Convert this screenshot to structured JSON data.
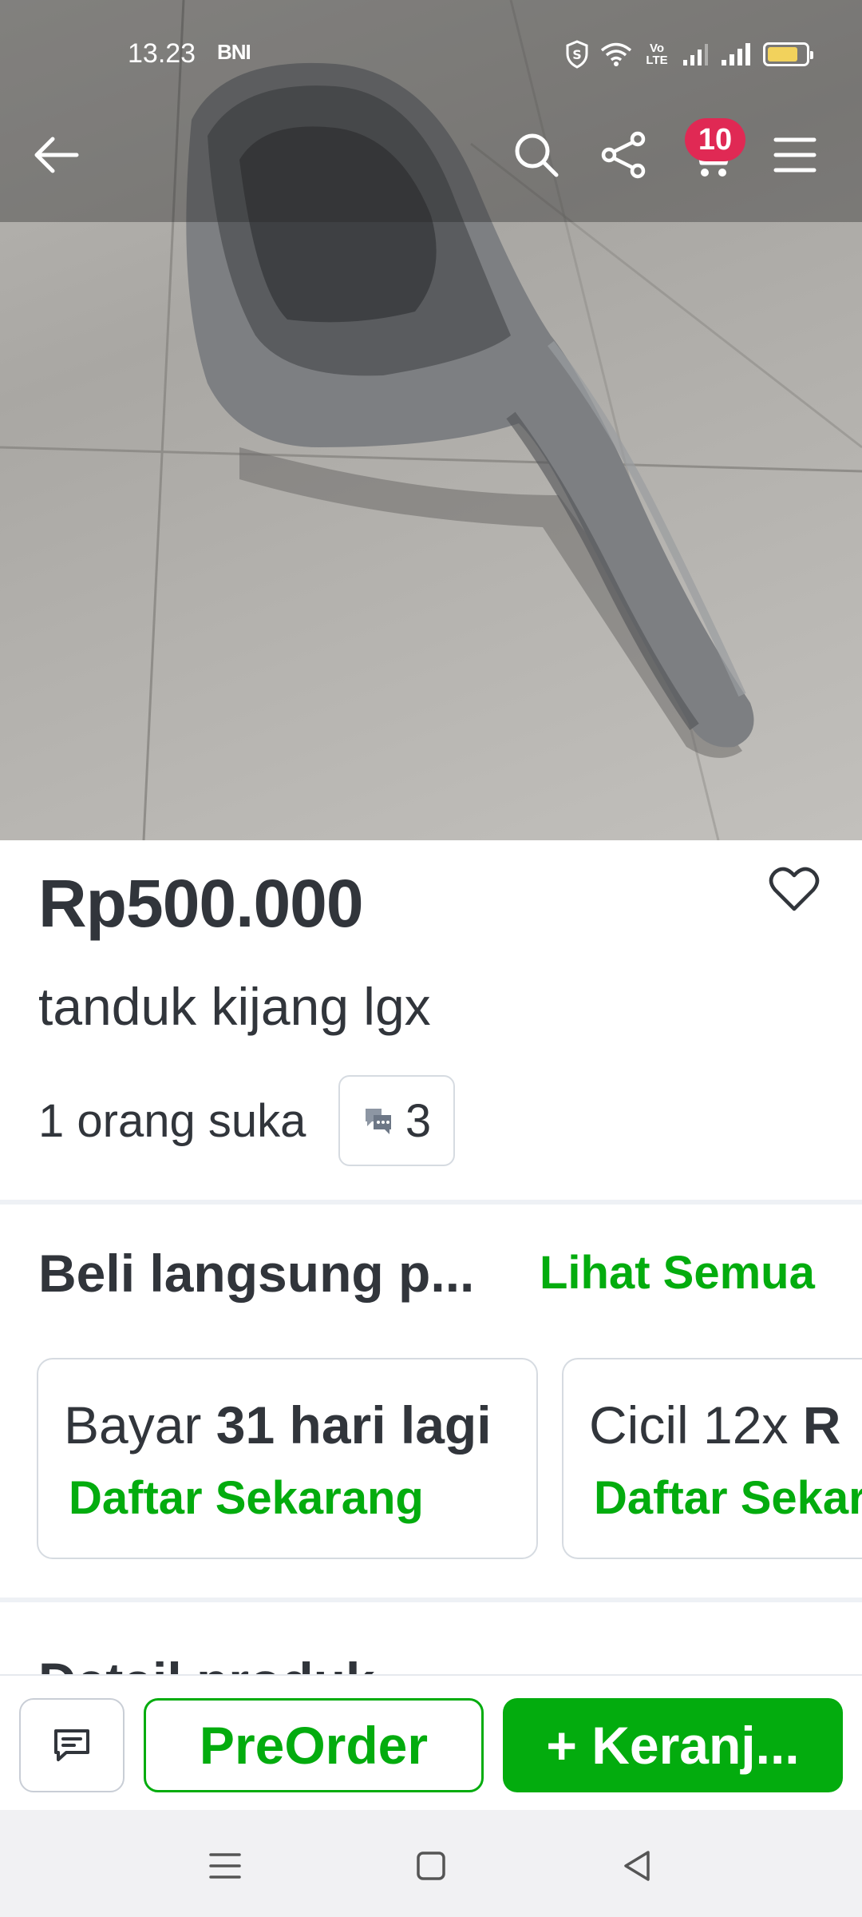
{
  "status_bar": {
    "time": "13.23",
    "carrier": "BNI",
    "volte": "Vo LTE",
    "battery_level": 0.8
  },
  "toolbar": {
    "cart_count": "10",
    "icons": [
      "back-arrow-icon",
      "search-icon",
      "share-icon",
      "cart-icon",
      "menu-icon"
    ]
  },
  "product": {
    "price": "Rp500.000",
    "title": "tanduk kijang lgx",
    "likes": "1 orang suka",
    "discussion_count": "3"
  },
  "payment_section": {
    "title": "Beli langsung p...",
    "see_all": "Lihat Semua",
    "cards": [
      {
        "prefix": "Bayar ",
        "highlight": "31 hari lagi",
        "action": "Daftar Sekarang"
      },
      {
        "prefix": "Cicil 12x ",
        "highlight": "R",
        "action": "Daftar Sekar"
      }
    ]
  },
  "next_section_peek": "Detail produk",
  "action_bar": {
    "preorder_label": "PreOrder",
    "cart_label": "+ Keranj..."
  },
  "colors": {
    "brand_green": "#03ac0e",
    "badge_red": "#e02954",
    "text_dark": "#31353b"
  }
}
